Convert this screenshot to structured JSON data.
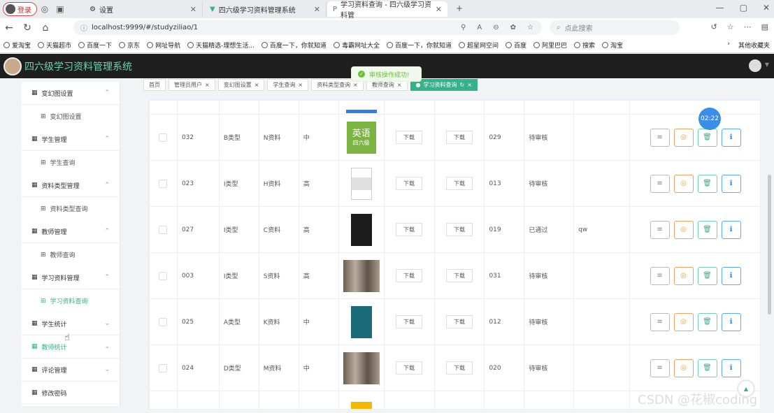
{
  "browser": {
    "profile_label": "登录",
    "tabs": [
      {
        "title": "设置"
      },
      {
        "title": "四六级学习资料管理系统"
      },
      {
        "title": "学习资料查询 - 四六级学习资料管"
      }
    ],
    "url": "localhost:9999/#/studyziliao/1",
    "search_placeholder": "点此搜索",
    "bookmarks": [
      "爱淘宝",
      "天猫超市",
      "百度一下",
      "京东",
      "网址导航",
      "天猫精选-理想生活...",
      "百度一下，你就知道",
      "毒霸网址大全",
      "百度一下，你就知道",
      "超星网空间",
      "百度",
      "阿里巴巴",
      "搜索",
      "淘宝"
    ],
    "other_bookmarks": "其他收藏夹"
  },
  "app": {
    "title": "四六级学习资料管理系统",
    "toast": "审核操作成功!",
    "timer": "02:22",
    "watermark": "CSDN @花椒coding"
  },
  "sidebar": {
    "groups": [
      {
        "label": "变幻图设置",
        "chevron": "up",
        "items": [
          "变幻图设置"
        ]
      },
      {
        "label": "学生管理",
        "chevron": "up",
        "items": [
          "学生查询"
        ]
      },
      {
        "label": "资料类型管理",
        "chevron": "up",
        "items": [
          "资料类型查询"
        ]
      },
      {
        "label": "教师管理",
        "chevron": "up",
        "items": [
          "教师查询"
        ]
      },
      {
        "label": "学习资料管理",
        "chevron": "up",
        "items": [
          "学习资料查询"
        ]
      },
      {
        "label": "学生统计",
        "chevron": "down",
        "items": []
      },
      {
        "label": "教师统计",
        "chevron": "down",
        "items": []
      },
      {
        "label": "评论管理",
        "chevron": "down",
        "items": []
      },
      {
        "label": "修改密码",
        "chevron": "",
        "items": []
      }
    ]
  },
  "tags": [
    "首页",
    "管理员用户",
    "变幻图设置",
    "学生查询",
    "资料类型查询",
    "教师查询",
    "学习资料查询"
  ],
  "table": {
    "download_label": "下载",
    "rows": [
      {
        "id": "032",
        "type": "B类型",
        "name": "N资料",
        "level": "中",
        "teacher": "029",
        "status": "待审核",
        "reply": "",
        "thumb_text": "英语",
        "thumb_sub": "四六级"
      },
      {
        "id": "023",
        "type": "I类型",
        "name": "H资料",
        "level": "高",
        "teacher": "013",
        "status": "待审核",
        "reply": ""
      },
      {
        "id": "027",
        "type": "I类型",
        "name": "C资料",
        "level": "高",
        "teacher": "019",
        "status": "已通过",
        "reply": "qw"
      },
      {
        "id": "003",
        "type": "I类型",
        "name": "S资料",
        "level": "高",
        "teacher": "031",
        "status": "待审核",
        "reply": ""
      },
      {
        "id": "025",
        "type": "A类型",
        "name": "K资料",
        "level": "中",
        "teacher": "012",
        "status": "待审核",
        "reply": ""
      },
      {
        "id": "024",
        "type": "D类型",
        "name": "M资料",
        "level": "中",
        "teacher": "020",
        "status": "待审核",
        "reply": ""
      }
    ]
  }
}
